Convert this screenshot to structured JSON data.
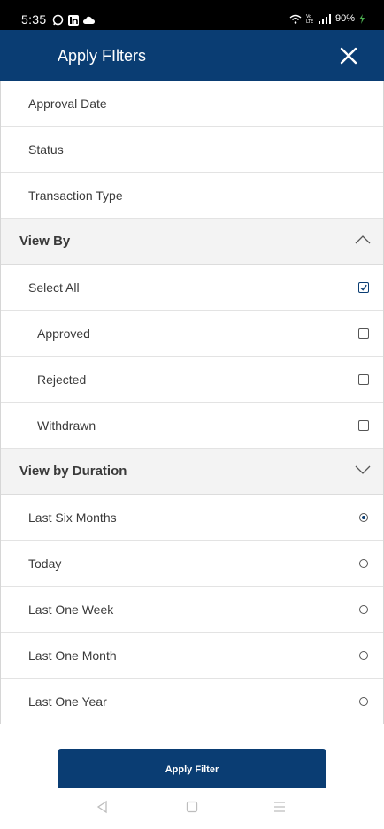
{
  "status_bar": {
    "time": "5:35",
    "battery": "90%",
    "network": "Vo LTE"
  },
  "header": {
    "title": "Apply FIlters",
    "close_icon": "close-icon"
  },
  "filters": {
    "approval_date": "Approval Date",
    "status": "Status",
    "transaction_type": "Transaction Type"
  },
  "view_by": {
    "label": "View By",
    "expanded": true,
    "items": [
      {
        "label": "Select All",
        "checked": true
      },
      {
        "label": "Approved",
        "checked": false
      },
      {
        "label": "Rejected",
        "checked": false
      },
      {
        "label": "Withdrawn",
        "checked": false
      }
    ]
  },
  "view_by_duration": {
    "label": "View by Duration",
    "expanded": false,
    "options": [
      {
        "label": "Last Six Months",
        "selected": true
      },
      {
        "label": "Today",
        "selected": false
      },
      {
        "label": "Last One Week",
        "selected": false
      },
      {
        "label": "Last One Month",
        "selected": false
      },
      {
        "label": "Last One Year",
        "selected": false
      }
    ]
  },
  "apply_button": "Apply Filter",
  "colors": {
    "primary": "#0a3d73",
    "section_bg": "#f3f3f3"
  }
}
